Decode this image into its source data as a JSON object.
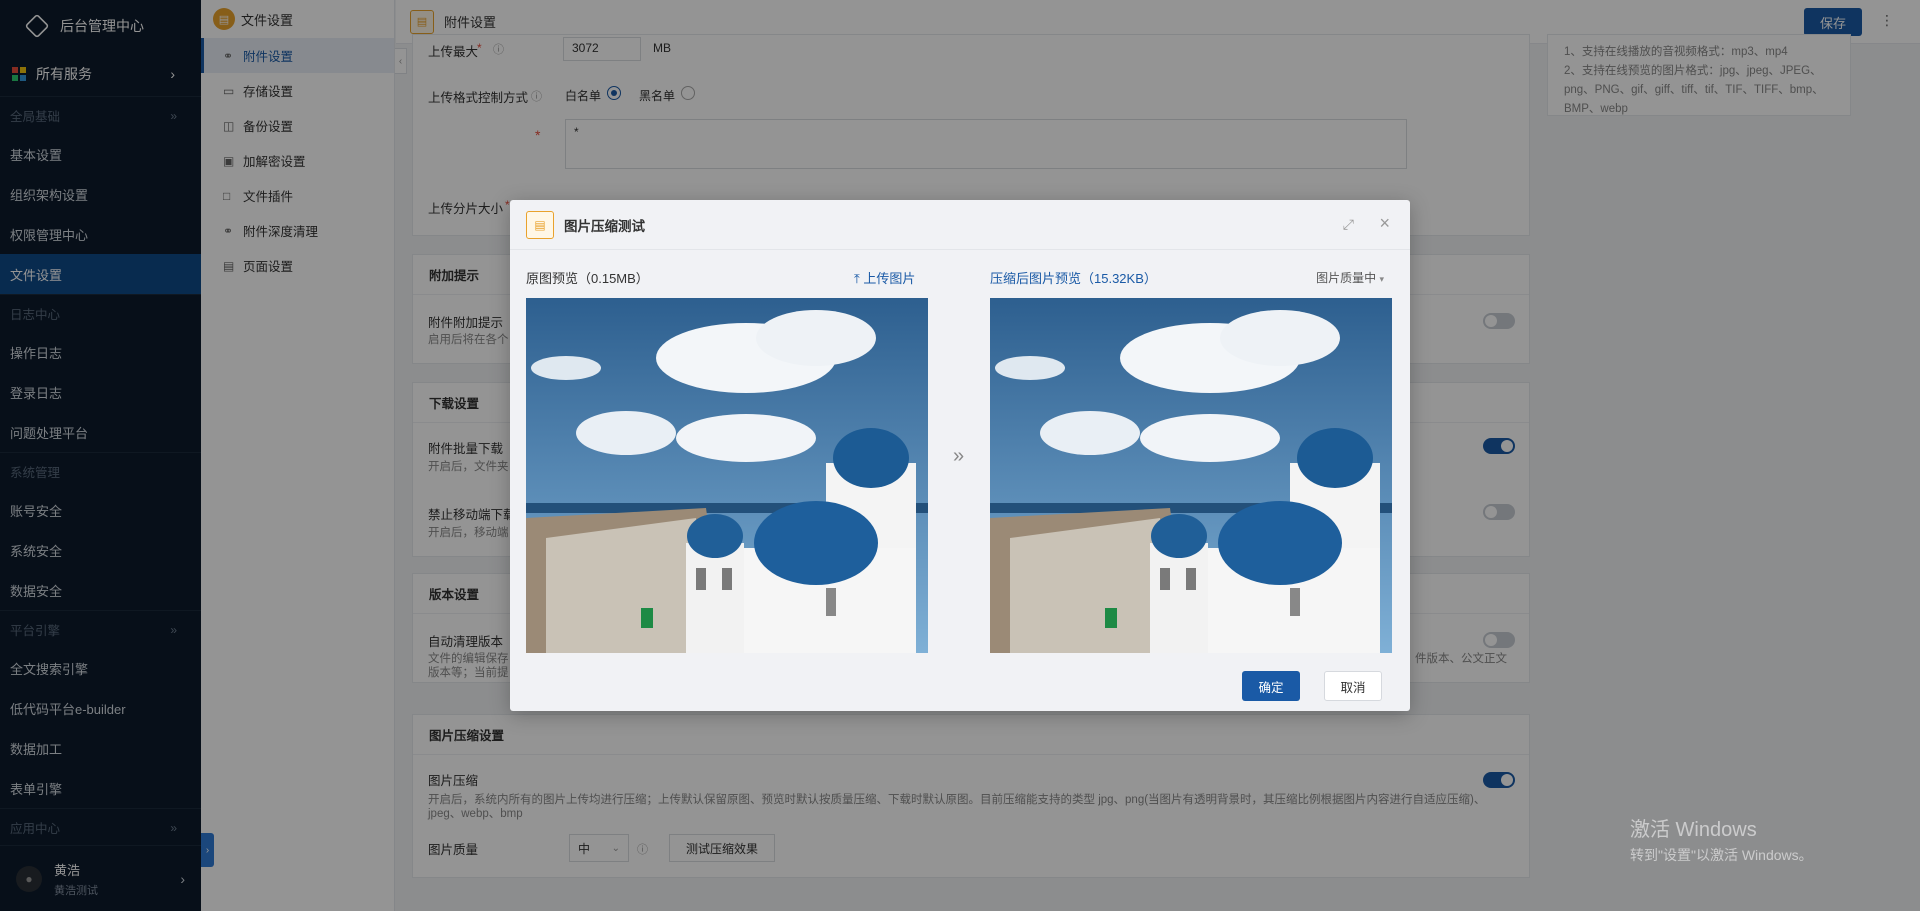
{
  "nav": {
    "brand": "后台管理中心",
    "all_services": "所有服务",
    "sections": [
      {
        "title": "全局基础",
        "items": [
          "基本设置",
          "组织架构设置",
          "权限管理中心",
          "文件设置"
        ]
      },
      {
        "title": "日志中心",
        "items": [
          "操作日志",
          "登录日志",
          "问题处理平台"
        ]
      },
      {
        "title": "系统管理",
        "items": [
          "账号安全",
          "系统安全",
          "数据安全"
        ]
      },
      {
        "title": "平台引擎",
        "items": [
          "全文搜索引擎",
          "低代码平台e-builder",
          "数据加工",
          "表单引擎"
        ]
      },
      {
        "title": "应用中心",
        "items": []
      }
    ],
    "user": {
      "name": "黄浩",
      "sub": "黄浩测试"
    }
  },
  "subnav": {
    "head": "文件设置",
    "items": [
      {
        "label": "附件设置",
        "icon": "paperclip-icon"
      },
      {
        "label": "存储设置",
        "icon": "storage-icon"
      },
      {
        "label": "备份设置",
        "icon": "backup-icon"
      },
      {
        "label": "加解密设置",
        "icon": "lock-icon"
      },
      {
        "label": "文件插件",
        "icon": "plugin-icon"
      },
      {
        "label": "附件深度清理",
        "icon": "clean-icon"
      },
      {
        "label": "页面设置",
        "icon": "page-icon"
      }
    ]
  },
  "topbar": {
    "title": "附件设置",
    "save": "保存"
  },
  "upload_settings": {
    "max_label": "上传最大",
    "max_value": "3072",
    "max_unit": "MB",
    "format_mode_label": "上传格式控制方式",
    "whitelist": "白名单",
    "blacklist": "黑名单",
    "format_value": "*",
    "chunk_label": "上传分片大小"
  },
  "tips": {
    "line1": "1、支持在线播放的音视频格式：mp3、mp4",
    "line2": "2、支持在线预览的图片格式：jpg、jpeg、JPEG、png、PNG、gif、giff、tiff、tif、TIF、TIFF、bmp、BMP、webp"
  },
  "extra_tips": {
    "head": "附加提示",
    "label": "附件附加提示",
    "desc": "启用后将在各个"
  },
  "download": {
    "head": "下载设置",
    "batch_label": "附件批量下载",
    "batch_desc": "开启后，文件夹",
    "mobile_label": "禁止移动端下载",
    "mobile_desc": "开启后，移动端"
  },
  "version": {
    "head": "版本设置",
    "label": "自动清理版本",
    "desc1": "文件的编辑保存",
    "desc1_tail": "件版本、公文正文",
    "desc2": "版本等；当前提"
  },
  "compress": {
    "head": "图片压缩设置",
    "label": "图片压缩",
    "desc": "开启后，系统内所有的图片上传均进行压缩；上传默认保留原图、预览时默认按质量压缩、下载时默认原图。目前压缩能支持的类型 jpg、png(当图片有透明背景时，其压缩比例根据图片内容进行自适应压缩)、jpeg、webp、bmp",
    "quality_label": "图片质量",
    "quality_value": "中",
    "test_button": "测试压缩效果"
  },
  "dialog": {
    "title": "图片压缩测试",
    "original_label": "原图预览（0.15MB）",
    "upload": "上传图片",
    "compressed_label": "压缩后图片预览（15.32KB）",
    "quality": "图片质量中",
    "ok": "确定",
    "cancel": "取消"
  },
  "watermark": {
    "line1": "激活 Windows",
    "line2": "转到\"设置\"以激活 Windows。"
  },
  "colors": {
    "primary": "#1a5aa6",
    "nav_bg": "#0d1b2c",
    "accent": "#e9a22c"
  }
}
